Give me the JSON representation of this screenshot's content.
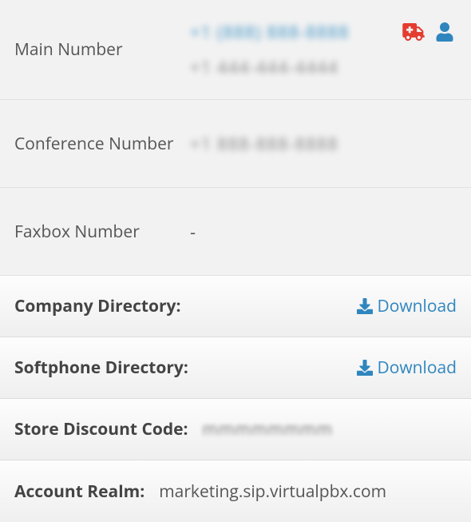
{
  "rows": {
    "main_number": {
      "label": "Main Number",
      "primary": "+1 (888) 888-8888",
      "secondary": "+1 444-444-4444"
    },
    "conference_number": {
      "label": "Conference Number",
      "value": "+1 888-888-8888"
    },
    "faxbox_number": {
      "label": "Faxbox Number",
      "value": "-"
    }
  },
  "sections": {
    "company_directory": {
      "label": "Company Directory:",
      "action": "Download"
    },
    "softphone_directory": {
      "label": "Softphone Directory:",
      "action": "Download"
    },
    "store_discount": {
      "label": "Store Discount Code:",
      "value": "mmmmmmmm"
    },
    "account_realm": {
      "label": "Account Realm:",
      "value": "marketing.sip.virtualpbx.com"
    }
  },
  "icons": {
    "emergency": "ambulance-icon",
    "user": "user-icon",
    "download": "download-icon"
  }
}
